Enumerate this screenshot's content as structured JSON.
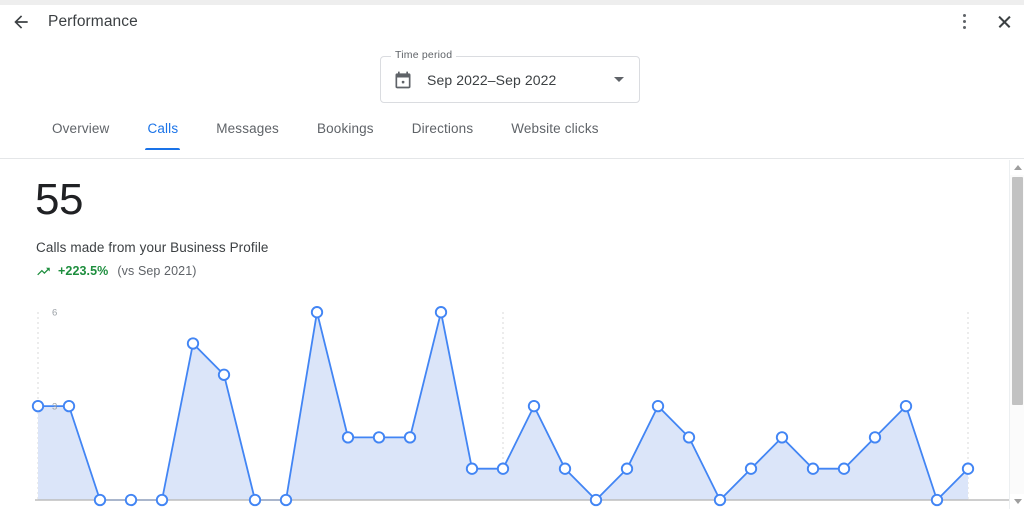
{
  "header": {
    "title": "Performance",
    "back_icon": "arrow-left-icon",
    "more_icon": "more-vertical-icon",
    "close_icon": "close-icon"
  },
  "time_period": {
    "legend": "Time period",
    "value": "Sep 2022–Sep 2022",
    "calendar_icon": "calendar-icon",
    "caret_icon": "chevron-down-icon"
  },
  "tabs": [
    {
      "label": "Overview",
      "active": false
    },
    {
      "label": "Calls",
      "active": true
    },
    {
      "label": "Messages",
      "active": false
    },
    {
      "label": "Bookings",
      "active": false
    },
    {
      "label": "Directions",
      "active": false
    },
    {
      "label": "Website clicks",
      "active": false
    }
  ],
  "stats": {
    "value": "55",
    "subtitle": "Calls made from your Business Profile",
    "delta": "+223.5%",
    "delta_comparison": "(vs Sep 2021)",
    "delta_color": "#1e8e3e",
    "trend_icon": "trending-up-icon"
  },
  "colors": {
    "accent": "#1a73e8",
    "line": "#4285f4",
    "area_fill": "#dbe5f9",
    "positive": "#1e8e3e",
    "text_primary": "#202124",
    "text_secondary": "#5f6368",
    "border": "#dadce0"
  },
  "scrollbar": {
    "up_icon": "caret-up-icon",
    "down_icon": "caret-down-icon",
    "thumb": "scrollbar-thumb"
  },
  "chart_data": {
    "type": "area",
    "title": "Calls made from your Business Profile",
    "xlabel": "",
    "ylabel": "",
    "ylim": [
      0,
      7
    ],
    "yticks": [
      3,
      6
    ],
    "ytick_labels": [
      "3",
      "6"
    ],
    "grid": "vertical-dotted",
    "gridlines_x": [
      0,
      15,
      30
    ],
    "legend": "none",
    "markers": true,
    "x": [
      0,
      1,
      2,
      3,
      4,
      5,
      6,
      7,
      8,
      9,
      10,
      11,
      12,
      13,
      14,
      15,
      16,
      17,
      18,
      19,
      20,
      21,
      22,
      23,
      24,
      25,
      26,
      27,
      28,
      29,
      30
    ],
    "values": [
      3,
      3,
      0,
      0,
      0,
      5,
      4,
      0,
      0,
      6,
      2,
      2,
      2,
      6,
      1,
      1,
      3,
      1,
      0,
      1,
      3,
      2,
      0,
      1,
      2,
      1,
      1,
      2,
      3,
      0,
      1
    ],
    "series": [
      {
        "name": "Calls",
        "values": [
          3,
          3,
          0,
          0,
          0,
          5,
          4,
          0,
          0,
          6,
          2,
          2,
          2,
          6,
          1,
          1,
          3,
          1,
          0,
          1,
          3,
          2,
          0,
          1,
          2,
          1,
          1,
          2,
          3,
          0,
          1
        ]
      }
    ]
  }
}
